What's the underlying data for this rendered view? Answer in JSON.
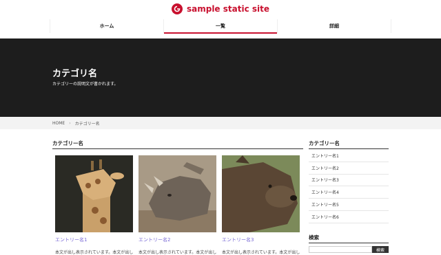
{
  "site": {
    "title": "sample static site"
  },
  "gnav": {
    "items": [
      "ホーム",
      "一覧",
      "詳細"
    ]
  },
  "hero": {
    "title": "カテゴリ名",
    "description": "カテゴリーの説明文が書かれます。"
  },
  "breadcrumb": {
    "home": "HOME",
    "current": "カテゴリー名"
  },
  "main": {
    "heading": "カテゴリー名",
    "cards": [
      {
        "title": "エントリー名1",
        "text": "本文が出し表示されています。本文が出し表示されています。"
      },
      {
        "title": "エントリー名2",
        "text": "本文が出し表示されています。本文が出し表示されています。"
      },
      {
        "title": "エントリー名3",
        "text": "本文が出し表示されています。本文が出し表示されています。"
      }
    ]
  },
  "sidebar": {
    "category_heading": "カテゴリー名",
    "entries": [
      "エントリー名1",
      "エントリー名2",
      "エントリー名3",
      "エントリー名4",
      "エントリー名5",
      "エントリー名6"
    ],
    "search_heading": "検索",
    "search_button": "検索"
  }
}
